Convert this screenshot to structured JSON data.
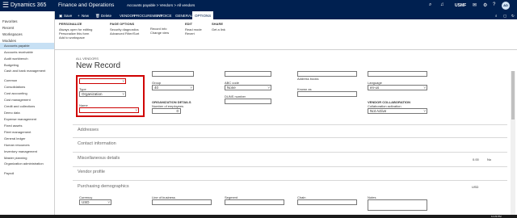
{
  "topbar": {
    "brand": "Dynamics 365",
    "module": "Finance and Operations",
    "breadcrumb": "Accounts payable  >  Vendors  >  All vendors",
    "company": "USMF",
    "avatar": "AD"
  },
  "sidebar": {
    "favorites": "Favorites",
    "recent": "Recent",
    "workspaces": "Workspaces",
    "modules": "Modules",
    "items": [
      "Accounts payable",
      "Accounts receivable",
      "Audit workbench",
      "Budgeting",
      "Cash and bank management",
      "Common",
      "Consolidations",
      "Cost accounting",
      "Cost management",
      "Credit and collections",
      "Demo data",
      "Expense management",
      "Fixed assets",
      "Fleet management",
      "General ledger",
      "Human resources",
      "Inventory management",
      "Master planning",
      "Organization administration",
      "Payroll"
    ]
  },
  "toolbar": {
    "save": "Save",
    "new": "New",
    "delete": "Delete",
    "tabs": [
      "VENDOR",
      "PROCUREMENT",
      "INVOICE",
      "GENERAL",
      "OPTIONS"
    ]
  },
  "ribbon": {
    "personalize": {
      "title": "PERSONALIZE",
      "items": [
        "Always open for editing",
        "Personalize this form",
        "Add to workspace"
      ]
    },
    "page_options": {
      "title": "PAGE OPTIONS",
      "items": [
        "Security diagnostics",
        "Advanced Filter/Sort"
      ]
    },
    "record": {
      "items": [
        "Record info",
        "Change view"
      ]
    },
    "edit": {
      "title": "EDIT",
      "items": [
        "Read mode",
        "Revert"
      ]
    },
    "share": {
      "title": "SHARE",
      "items": [
        "Get a link"
      ]
    }
  },
  "page": {
    "breadcrumb": "ALL VENDORS",
    "title": "New Record"
  },
  "form": {
    "type_label": "Type",
    "type_value": "Organization",
    "name_label": "Name",
    "group_label": "Group",
    "group_value": "40",
    "org_details": "ORGANIZATION DETAILS",
    "employees_label": "Number of employees",
    "employees_value": "0",
    "abc_label": "ABC code",
    "abc_value": "None",
    "duns_label": "DUNS number",
    "known_as_label": "Known as",
    "address_books_label": "Address books",
    "language_label": "Language",
    "language_value": "en-us",
    "collab_title": "VENDOR COLLABORATION",
    "collab_label": "Collaboration activation",
    "collab_value": "Not Active"
  },
  "sections": {
    "addresses": "Addresses",
    "contact": "Contact information",
    "misc": "Miscellaneous details",
    "misc_right": [
      "0.00",
      "No"
    ],
    "profile": "Vendor profile",
    "purchasing": "Purchasing demographics",
    "purchasing_right": "USD"
  },
  "purchasing": {
    "currency_label": "Currency",
    "currency_value": "USD",
    "lob_label": "Line of business",
    "segment_label": "Segment",
    "chain_label": "Chain",
    "notes_label": "Notes"
  },
  "status": {
    "time": "11:23 PM"
  }
}
